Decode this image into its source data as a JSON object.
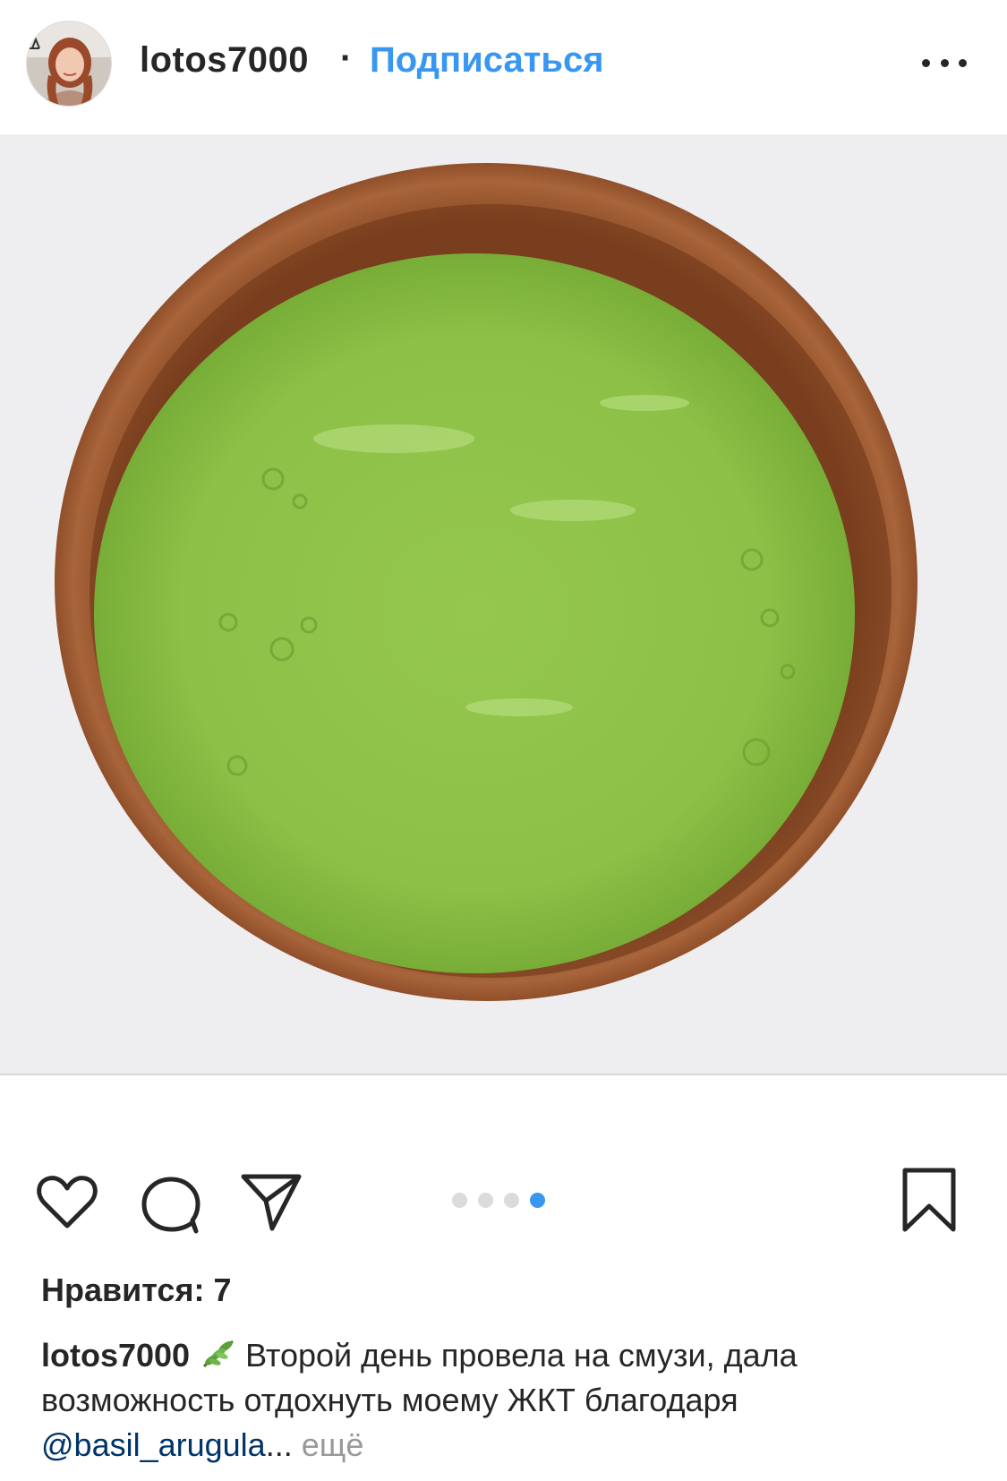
{
  "header": {
    "username": "lotos7000",
    "separator": "·",
    "follow_label": "Подписаться"
  },
  "icons": {
    "more": "more-horizontal-icon",
    "like": "heart-icon",
    "comment": "comment-bubble-icon",
    "share": "paper-plane-icon",
    "save": "bookmark-icon",
    "caption_emoji": "herb-leaf-icon"
  },
  "photo": {
    "pager": {
      "total": 4,
      "current": 4
    }
  },
  "likes": {
    "text": "Нравится: 7"
  },
  "caption": {
    "username": "lotos7000",
    "text": "Второй день провела на смузи, дала возможность отдохнуть моему ЖКТ благодаря",
    "mention": "@basil_arugula",
    "ellipsis": "...",
    "more_label": "ещё"
  },
  "colors": {
    "accent_blue": "#3897f0",
    "mention": "#003569",
    "muted": "#999999",
    "text": "#262626"
  }
}
